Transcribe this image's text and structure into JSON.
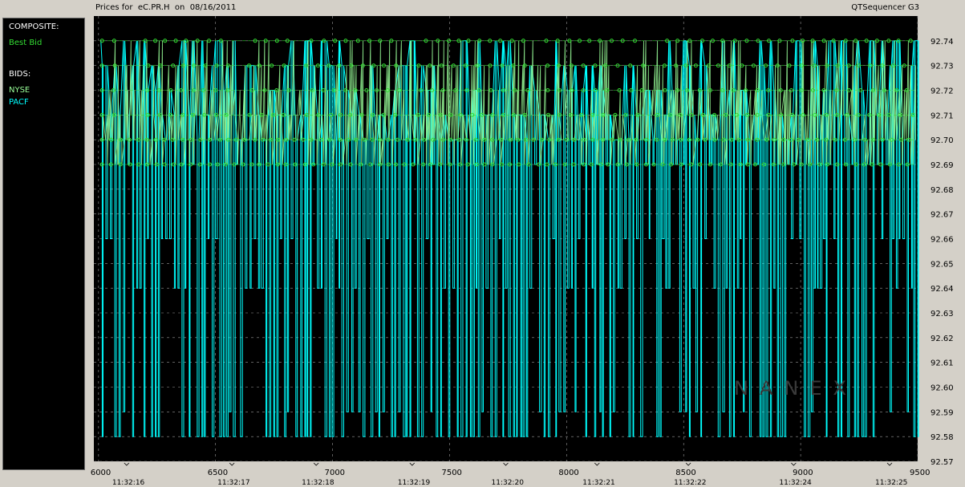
{
  "header": {
    "title": "Prices for  eC.PR.H  on  08/16/2011",
    "app_name": "QTSequencer G3"
  },
  "legend": {
    "composite_heading": "COMPOSITE:",
    "composite_items": [
      {
        "label": "Best Bid",
        "color": "#33dd33"
      }
    ],
    "bids_heading": "BIDS:",
    "bid_items": [
      {
        "label": "NYSE",
        "color": "#99ff99"
      },
      {
        "label": "PACF",
        "color": "#00ffff"
      }
    ]
  },
  "watermark": "NANEX",
  "colors": {
    "plot_bg": "#000000",
    "grid": "#9a9a9a",
    "pacf": "#00ffff",
    "nyse": "#99ff99",
    "best_bid": "#33dd33"
  },
  "chart_data": {
    "type": "line",
    "x_sequence_ticks": [
      6000,
      6500,
      7000,
      7500,
      8000,
      8500,
      9000,
      9500
    ],
    "x_time_ticks": [
      {
        "seq": 6120,
        "label": "11:32:16"
      },
      {
        "seq": 6570,
        "label": "11:32:17"
      },
      {
        "seq": 6930,
        "label": "11:32:18"
      },
      {
        "seq": 7340,
        "label": "11:32:19"
      },
      {
        "seq": 7740,
        "label": "11:32:20"
      },
      {
        "seq": 8130,
        "label": "11:32:21"
      },
      {
        "seq": 8520,
        "label": "11:32:22"
      },
      {
        "seq": 8970,
        "label": "11:32:24"
      },
      {
        "seq": 9380,
        "label": "11:32:25"
      }
    ],
    "xlim": [
      5980,
      9500
    ],
    "y_ticks": [
      "92.74",
      "92.73",
      "92.72",
      "92.71",
      "92.70",
      "92.69",
      "92.68",
      "92.67",
      "92.66",
      "92.65",
      "92.64",
      "92.63",
      "92.62",
      "92.61",
      "92.60",
      "92.59",
      "92.58",
      "92.57"
    ],
    "ylim": [
      92.57,
      92.75
    ],
    "series": [
      {
        "name": "Best Bid",
        "style": "dots",
        "levels": [
          92.74,
          92.73,
          92.72,
          92.71,
          92.7,
          92.69
        ]
      },
      {
        "name": "NYSE",
        "style": "line",
        "range": [
          92.69,
          92.74
        ]
      },
      {
        "name": "PACF",
        "style": "line",
        "range": [
          92.58,
          92.74
        ]
      }
    ],
    "legend_position": "left",
    "grid": true
  }
}
